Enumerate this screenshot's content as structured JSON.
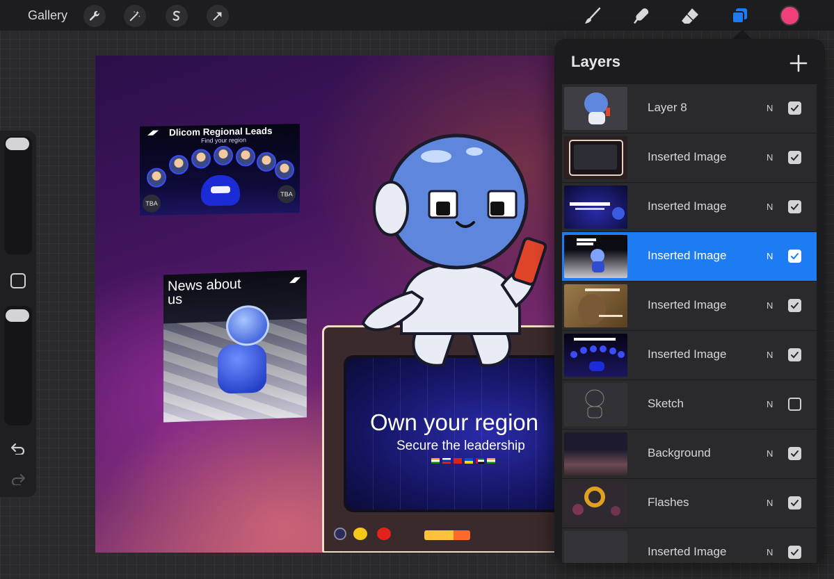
{
  "toolbar": {
    "gallery_label": "Gallery",
    "left_tools": [
      "wrench-icon",
      "magic-wand-icon",
      "selection-s-icon",
      "transform-arrow-icon"
    ],
    "right_tools": [
      "brush-icon",
      "smudge-icon",
      "eraser-icon",
      "layers-icon"
    ],
    "active_color": "#f0407a",
    "accent": "#1e7cf2"
  },
  "sidebar": {
    "controls": [
      "brush-size-slider",
      "modify-button",
      "opacity-slider",
      "undo-icon",
      "redo-icon"
    ]
  },
  "canvas": {
    "card_leads": {
      "title": "Dlicom Regional Leads",
      "subtitle": "Find your region",
      "tba_left": "TBA",
      "tba_right": "TBA"
    },
    "card_news": {
      "title": "News about us"
    },
    "tv": {
      "headline": "Own your region",
      "subline": "Secure the leadership"
    }
  },
  "layers": {
    "title": "Layers",
    "items": [
      {
        "name": "Layer 8",
        "blend": "N",
        "visible": true,
        "selected": false,
        "thumb": "robot"
      },
      {
        "name": "Inserted Image",
        "blend": "N",
        "visible": true,
        "selected": false,
        "thumb": "tv-frame"
      },
      {
        "name": "Inserted Image",
        "blend": "N",
        "visible": true,
        "selected": false,
        "thumb": "own-region"
      },
      {
        "name": "Inserted Image",
        "blend": "N",
        "visible": true,
        "selected": true,
        "thumb": "news"
      },
      {
        "name": "Inserted Image",
        "blend": "N",
        "visible": true,
        "selected": false,
        "thumb": "sand"
      },
      {
        "name": "Inserted Image",
        "blend": "N",
        "visible": true,
        "selected": false,
        "thumb": "leads"
      },
      {
        "name": "Sketch",
        "blend": "N",
        "visible": false,
        "selected": false,
        "thumb": "sketch"
      },
      {
        "name": "Background",
        "blend": "N",
        "visible": true,
        "selected": false,
        "thumb": "background"
      },
      {
        "name": "Flashes",
        "blend": "N",
        "visible": true,
        "selected": false,
        "thumb": "flashes"
      },
      {
        "name": "Inserted Image",
        "blend": "N",
        "visible": true,
        "selected": false,
        "thumb": "partial"
      }
    ]
  }
}
